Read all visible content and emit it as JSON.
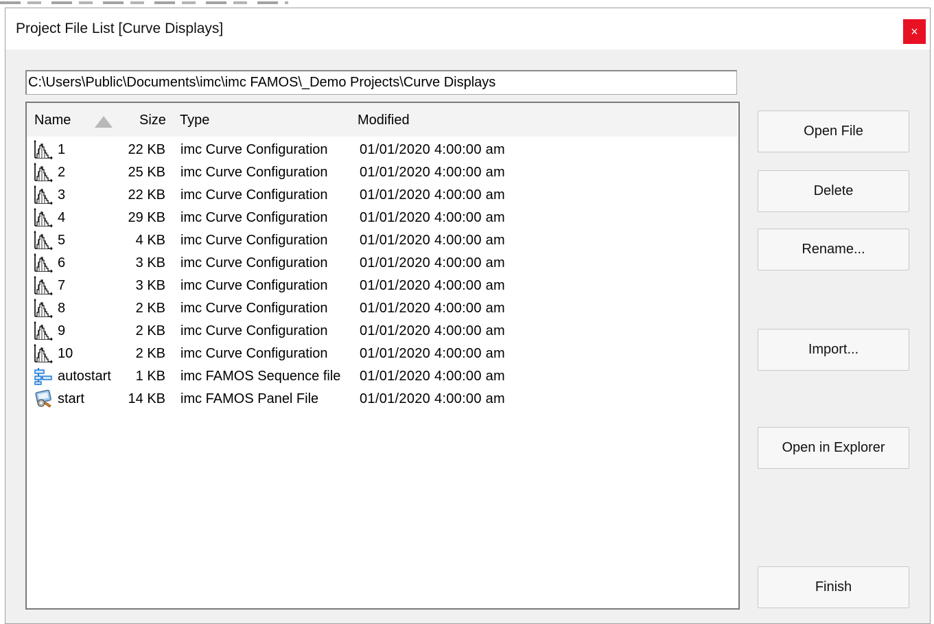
{
  "window": {
    "title": "Project File List [Curve Displays]",
    "close_label": "×"
  },
  "path": "C:\\Users\\Public\\Documents\\imc\\imc FAMOS\\_Demo Projects\\Curve Displays",
  "columns": {
    "name": "Name",
    "size": "Size",
    "type": "Type",
    "modified": "Modified",
    "sort_indicator": "sort-ascending-icon"
  },
  "files": [
    {
      "icon": "curve-configuration-icon",
      "name": "1",
      "size": "22 KB",
      "type": "imc Curve Configuration",
      "modified": "01/01/2020 4:00:00 am"
    },
    {
      "icon": "curve-configuration-icon",
      "name": "2",
      "size": "25 KB",
      "type": "imc Curve Configuration",
      "modified": "01/01/2020 4:00:00 am"
    },
    {
      "icon": "curve-configuration-icon",
      "name": "3",
      "size": "22 KB",
      "type": "imc Curve Configuration",
      "modified": "01/01/2020 4:00:00 am"
    },
    {
      "icon": "curve-configuration-icon",
      "name": "4",
      "size": "29 KB",
      "type": "imc Curve Configuration",
      "modified": "01/01/2020 4:00:00 am"
    },
    {
      "icon": "curve-configuration-icon",
      "name": "5",
      "size": "4 KB",
      "type": "imc Curve Configuration",
      "modified": "01/01/2020 4:00:00 am"
    },
    {
      "icon": "curve-configuration-icon",
      "name": "6",
      "size": "3 KB",
      "type": "imc Curve Configuration",
      "modified": "01/01/2020 4:00:00 am"
    },
    {
      "icon": "curve-configuration-icon",
      "name": "7",
      "size": "3 KB",
      "type": "imc Curve Configuration",
      "modified": "01/01/2020 4:00:00 am"
    },
    {
      "icon": "curve-configuration-icon",
      "name": "8",
      "size": "2 KB",
      "type": "imc Curve Configuration",
      "modified": "01/01/2020 4:00:00 am"
    },
    {
      "icon": "curve-configuration-icon",
      "name": "9",
      "size": "2 KB",
      "type": "imc Curve Configuration",
      "modified": "01/01/2020 4:00:00 am"
    },
    {
      "icon": "curve-configuration-icon",
      "name": "10",
      "size": "2 KB",
      "type": "imc Curve Configuration",
      "modified": "01/01/2020 4:00:00 am"
    },
    {
      "icon": "sequence-file-icon",
      "name": "autostart",
      "size": "1 KB",
      "type": "imc FAMOS Sequence file",
      "modified": "01/01/2020 4:00:00 am"
    },
    {
      "icon": "panel-file-icon",
      "name": "start",
      "size": "14 KB",
      "type": "imc FAMOS Panel File",
      "modified": "01/01/2020 4:00:00 am"
    }
  ],
  "buttons": {
    "open_file": "Open File",
    "delete": "Delete",
    "rename": "Rename...",
    "import": "Import...",
    "open_in_explorer": "Open in Explorer",
    "finish": "Finish"
  },
  "colors": {
    "close_button": "#e81123",
    "dialog_background": "#f0f0f0",
    "header_background": "#f3f3f3",
    "sequence_icon": "#1e7ad6"
  }
}
